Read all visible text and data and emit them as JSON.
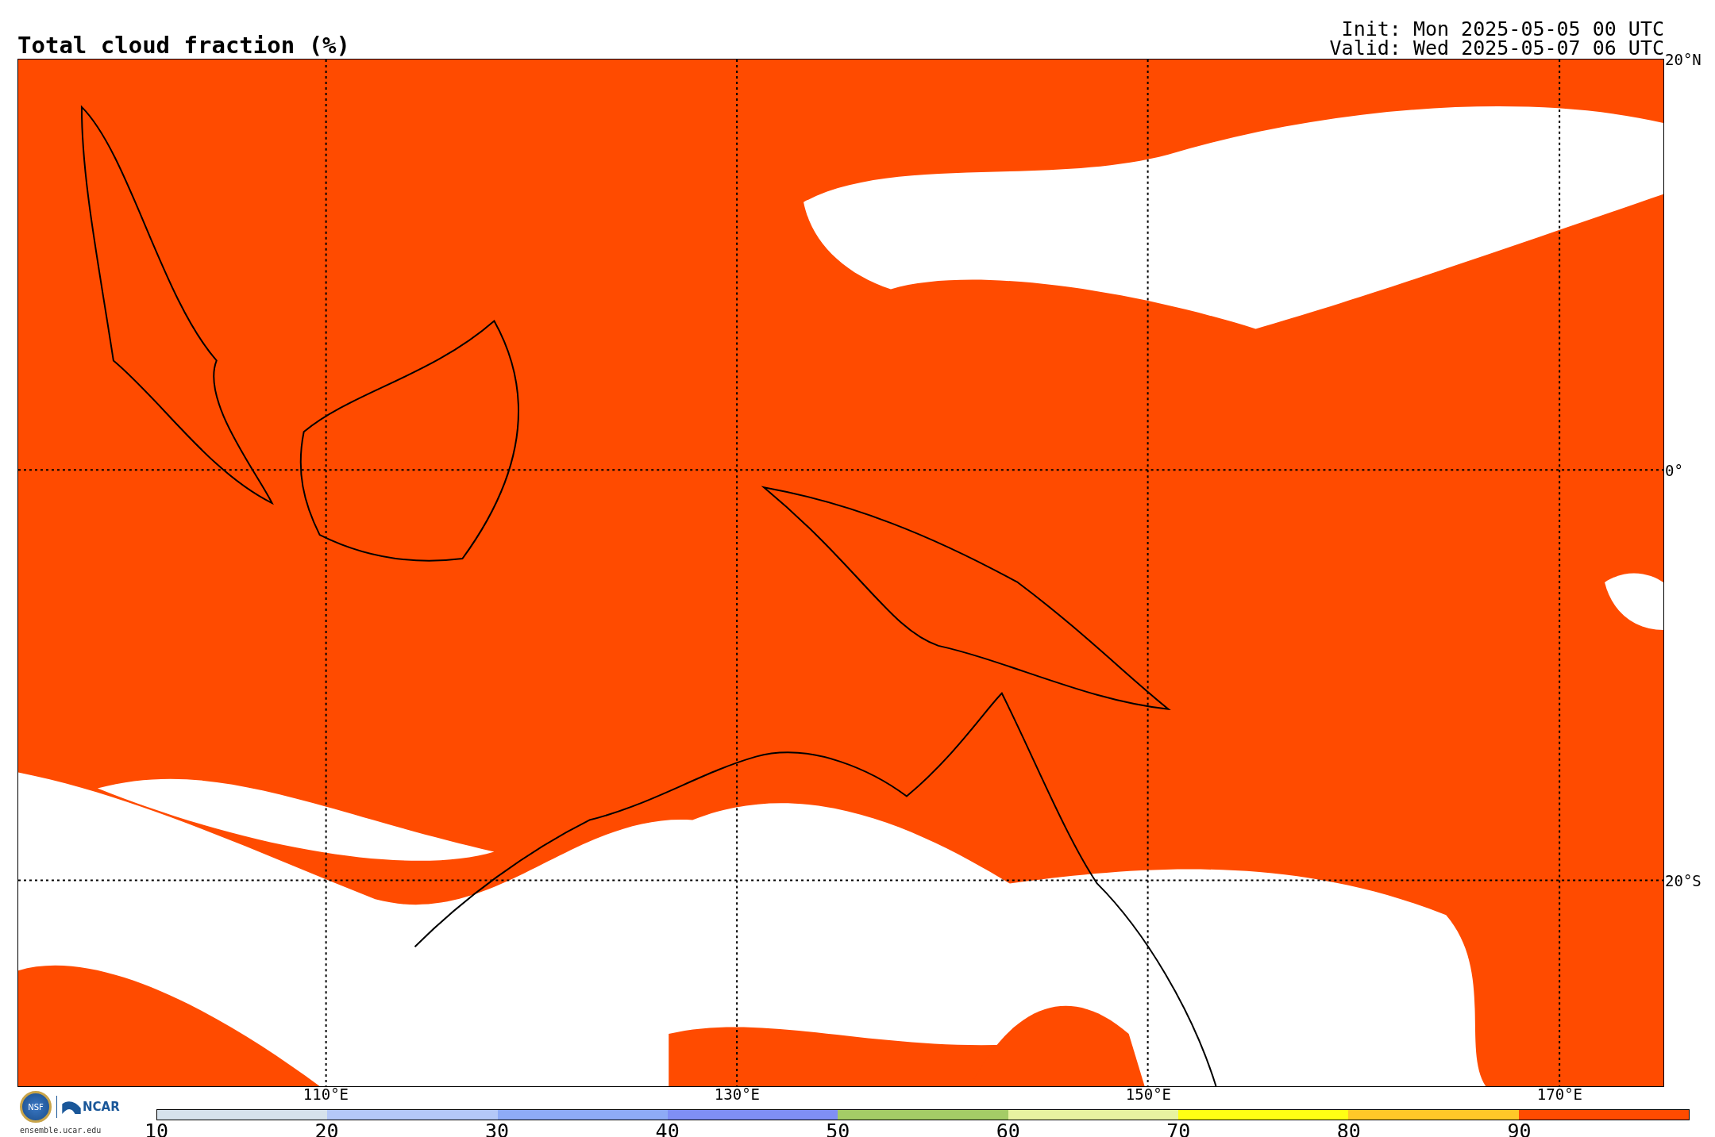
{
  "title": "Total cloud fraction (%)",
  "init": "Init: Mon 2025-05-05 00 UTC",
  "valid": "Valid: Wed 2025-05-07 06 UTC",
  "map": {
    "lat_labels": [
      "20°N",
      "0°",
      "20°S"
    ],
    "lon_labels": [
      "110°E",
      "130°E",
      "150°E",
      "170°E"
    ]
  },
  "logos": {
    "nsf": "NSF",
    "ncar": "NCAR",
    "url": "ensemble.ucar.edu"
  },
  "colorbar": {
    "ticks": [
      "10",
      "20",
      "30",
      "40",
      "50",
      "60",
      "70",
      "80",
      "90"
    ],
    "bins": [
      {
        "color": "#d6e2ec"
      },
      {
        "color": "#b4c8f8"
      },
      {
        "color": "#8eabf6"
      },
      {
        "color": "#7f8ff5"
      },
      {
        "color": "#a4cc66"
      },
      {
        "color": "#e8f3a0"
      },
      {
        "color": "#ffff14"
      },
      {
        "color": "#ffc828"
      },
      {
        "color": "#ff4b00"
      }
    ]
  }
}
